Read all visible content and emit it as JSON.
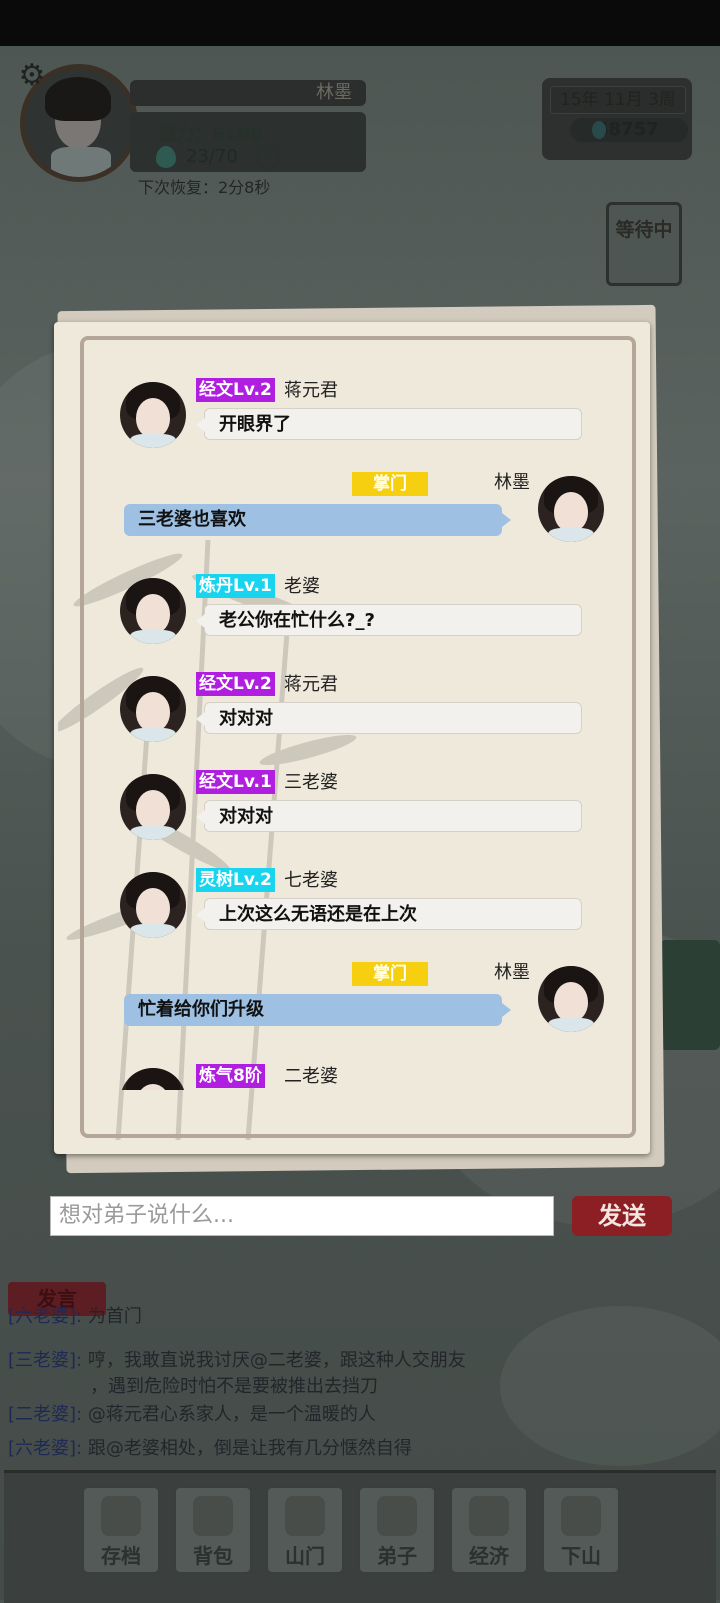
{
  "player": {
    "name": "林墨",
    "power_label": "战力：6108",
    "stamina": "23/70",
    "recover": "下次恢复：2分8秒"
  },
  "date": "15年 11月  3周",
  "money": "58757",
  "waiting_label": "等待中",
  "messages": [
    {
      "side": "left",
      "badge": "经文Lv.2",
      "badge_color": "#b01ee0",
      "name": "蒋元君",
      "text": "开眼界了"
    },
    {
      "side": "right",
      "badge": "掌门",
      "badge_color": "#f5cf10",
      "name": "林墨",
      "text": "三老婆也喜欢"
    },
    {
      "side": "left",
      "badge": "炼丹Lv.1",
      "badge_color": "#18d4ee",
      "name": "老婆",
      "text": "老公你在忙什么?_?"
    },
    {
      "side": "left",
      "badge": "经文Lv.2",
      "badge_color": "#b01ee0",
      "name": "蒋元君",
      "text": "对对对"
    },
    {
      "side": "left",
      "badge": "经文Lv.1",
      "badge_color": "#b01ee0",
      "name": "三老婆",
      "text": "对对对"
    },
    {
      "side": "left",
      "badge": "灵树Lv.2",
      "badge_color": "#18d4ee",
      "name": "七老婆",
      "text": "上次这么无语还是在上次"
    },
    {
      "side": "right",
      "badge": "掌门",
      "badge_color": "#f5cf10",
      "name": "林墨",
      "text": "忙着给你们升级"
    },
    {
      "side": "left",
      "badge": "炼气8阶",
      "badge_color": "#b01ee0",
      "name": "二老婆",
      "text": ""
    }
  ],
  "input": {
    "placeholder": "想对弟子说什么..."
  },
  "send_label": "发送",
  "speak_label": "发言",
  "feed": [
    {
      "name": "[六老婆]:",
      "text": "为首门"
    },
    {
      "name": "[三老婆]:",
      "text": "哼，我敢直说我讨厌@二老婆，跟这种人交朋友"
    },
    {
      "name": "",
      "text": "，遇到危险时怕不是要被推出去挡刀"
    },
    {
      "name": "[二老婆]:",
      "text": "@蒋元君心系家人，是一个温暖的人"
    },
    {
      "name": "[六老婆]:",
      "text": "跟@老婆相处，倒是让我有几分惬然自得"
    }
  ],
  "nav": [
    "存档",
    "背包",
    "山门",
    "弟子",
    "经济",
    "下山"
  ]
}
